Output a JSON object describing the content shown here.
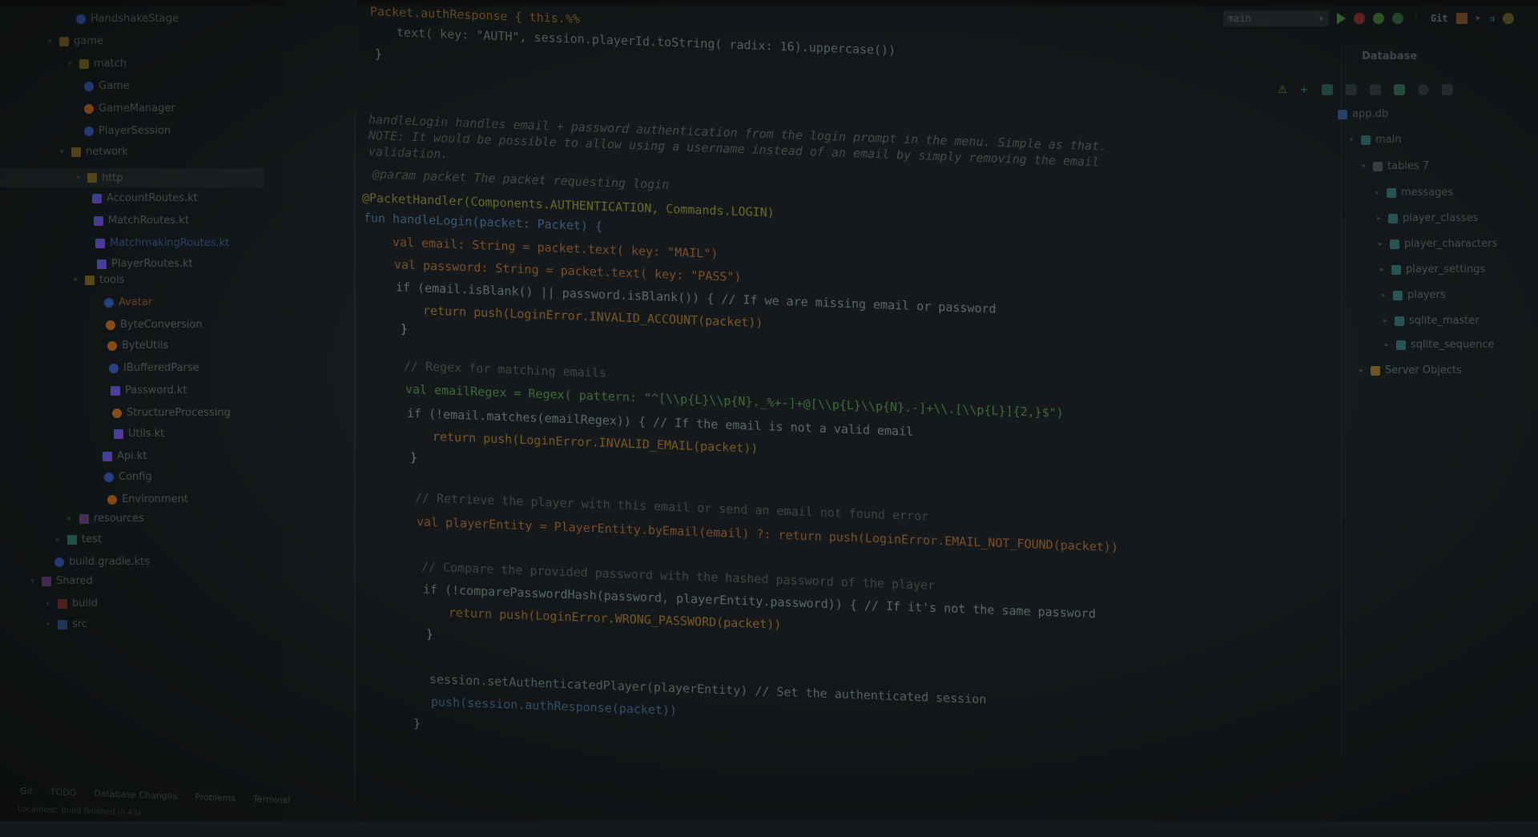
{
  "toolbar": {
    "config_label": "main",
    "git_label": "Git"
  },
  "project_tree": [
    {
      "label": "HandshakeStage",
      "icon": "class"
    },
    {
      "label": "game",
      "icon": "folder"
    },
    {
      "label": "match",
      "icon": "folder"
    },
    {
      "label": "Game",
      "icon": "class"
    },
    {
      "label": "GameManager",
      "icon": "object"
    },
    {
      "label": "PlayerSession",
      "icon": "class"
    },
    {
      "label": "network",
      "icon": "folder"
    },
    {
      "label": "http",
      "icon": "folder"
    },
    {
      "label": "AccountRoutes.kt",
      "icon": "kotlin"
    },
    {
      "label": "MatchRoutes.kt",
      "icon": "kotlin"
    },
    {
      "label": "MatchmakingRoutes.kt",
      "icon": "kotlin"
    },
    {
      "label": "PlayerRoutes.kt",
      "icon": "kotlin"
    },
    {
      "label": "tools",
      "icon": "folder"
    },
    {
      "label": "Avatar",
      "icon": "class"
    },
    {
      "label": "ByteConversion",
      "icon": "object"
    },
    {
      "label": "ByteUtils",
      "icon": "object"
    },
    {
      "label": "IBufferedParse",
      "icon": "class"
    },
    {
      "label": "Password.kt",
      "icon": "kotlin"
    },
    {
      "label": "StructureProcessing",
      "icon": "object"
    },
    {
      "label": "Utils.kt",
      "icon": "kotlin"
    },
    {
      "label": "Api.kt",
      "icon": "kotlin"
    },
    {
      "label": "Config",
      "icon": "class"
    },
    {
      "label": "Environment",
      "icon": "object"
    },
    {
      "label": "resources",
      "icon": "folder-purple"
    },
    {
      "label": "test",
      "icon": "folder-teal"
    },
    {
      "label": "build.gradle.kts",
      "icon": "gradle"
    },
    {
      "label": "Shared",
      "icon": "folder-purple"
    },
    {
      "label": "build",
      "icon": "folder-red"
    },
    {
      "label": "src",
      "icon": "folder-db"
    }
  ],
  "code": {
    "line1": "Packet.authResponse { this.%%",
    "line2": "text( key: \"AUTH\", session.playerId.toString( radix: 16).uppercase())",
    "line3": "}",
    "doc1": "handleLogin handles email + password authentication from the login prompt in the menu. Simple as that.",
    "doc2": "NOTE: It would be possible to allow using a username instead of an email by simply removing the email",
    "doc3": "validation.",
    "doc4": "@param packet The packet requesting login",
    "ann": "@PacketHandler(Components.AUTHENTICATION, Commands.LOGIN)",
    "fun": "fun handleLogin(packet: Packet) {",
    "v1": "val email: String = packet.text( key: \"MAIL\")",
    "v2": "val password: String = packet.text( key: \"PASS\")",
    "if1": "if (email.isBlank() || password.isBlank()) { // If we are missing email or password",
    "ret1": "return push(LoginError.INVALID_ACCOUNT(packet))",
    "close1": "}",
    "cmt2": "// Regex for matching emails",
    "regex": "val emailRegex = Regex( pattern: \"^[\\\\p{L}\\\\p{N}._%+-]+@[\\\\p{L}\\\\p{N}.-]+\\\\.[\\\\p{L}]{2,}$\")",
    "if2": "if (!email.matches(emailRegex)) { // If the email is not a valid email",
    "ret2": "return push(LoginError.INVALID_EMAIL(packet))",
    "close2": "}",
    "cmt3": "// Retrieve the player with this email or send an email not found error",
    "v3": "val playerEntity = PlayerEntity.byEmail(email) ?: return push(LoginError.EMAIL_NOT_FOUND(packet))",
    "cmt4": "// Compare the provided password with the hashed password of the player",
    "if3": "if (!comparePasswordHash(password, playerEntity.password)) { // If it's not the same password",
    "ret3": "return push(LoginError.WRONG_PASSWORD(packet))",
    "close3": "}",
    "s1": "session.setAuthenticatedPlayer(playerEntity) // Set the authenticated session",
    "s2": "push(session.authResponse(packet))",
    "close4": "}"
  },
  "database": {
    "title": "Database",
    "root": "app.db",
    "schema": "main",
    "tables_label": "tables 7",
    "tables": [
      "messages",
      "player_classes",
      "player_characters",
      "player_settings",
      "players",
      "sqlite_master",
      "sqlite_sequence"
    ],
    "server_objects": "Server Objects"
  },
  "bottom_tabs": [
    "Git",
    "TODO",
    "Database Changes",
    "Problems",
    "Terminal"
  ],
  "status_text": "Localhost: Build finished in 43s"
}
